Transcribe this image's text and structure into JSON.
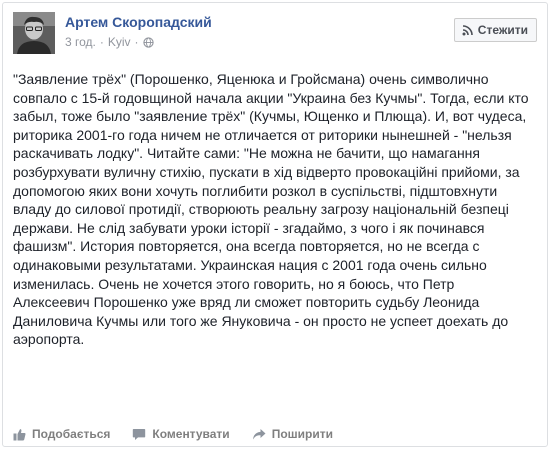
{
  "post": {
    "author": "Артем Скоропадский",
    "time": "3 год.",
    "separator": "·",
    "location": "Kyiv",
    "follow_label": "Стежити",
    "text": "\"Заявление трёх\" (Порошенко, Яценюка и Гройсмана) очень символично совпало с 15-й годовщиной начала акции \"Украина без Кучмы\". Тогда, если кто забыл, тоже было \"заявление трёх\" (Кучмы, Ющенко и Плюща). И, вот чудеса, риторика 2001-го года ничем не отличается от риторики нынешней - \"нельзя раскачивать лодку\". Читайте сами: \"Не можна не бачити, що намагання розбурхувати вуличну стихію, пускати в хід відверто провокаційні прийоми, за допомогою яких вони хочуть поглибити розкол в суспільстві, підштовхнути владу до силової протидії, створюють реальну загрозу національній безпеці держави. Не слід забувати уроки історії - згадаймо, з чого і як починався фашизм\". История повторяется, она всегда повторяется, но не всегда с одинаковыми результатами. Украинская нация с 2001 года очень сильно изменилась. Очень не хочется этого говорить, но я боюсь, что Петр Алексеевич Порошенко уже вряд ли сможет повторить судьбу Леонида Даниловича Кучмы или того же Януковича - он просто не успеет доехать до аэропорта."
  },
  "actions": {
    "like_label": "Подобається",
    "comment_label": "Коментувати",
    "share_label": "Поширити"
  },
  "icons": {
    "globe": "globe-icon",
    "follow": "rss-icon",
    "like": "thumbs-up-icon",
    "comment": "comment-icon",
    "share": "share-arrow-icon"
  },
  "colors": {
    "author_link": "#365899",
    "meta_text": "#90949c",
    "body_text": "#1d2129",
    "action_text": "#7f7f7f"
  }
}
